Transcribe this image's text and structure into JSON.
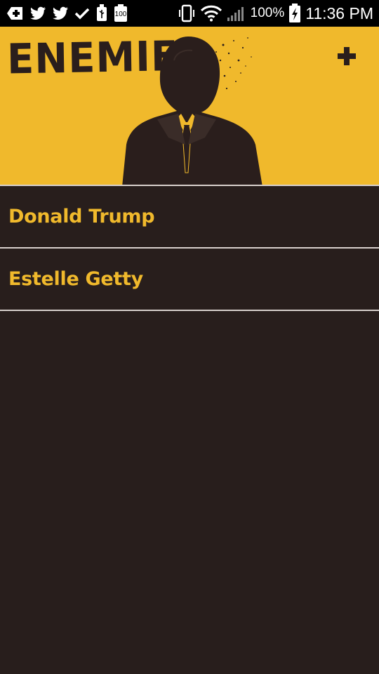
{
  "status_bar": {
    "battery_text": "100%",
    "battery_small_label": "100",
    "time": "11:36 PM",
    "icons": [
      "plus-badge-icon",
      "twitter-icon",
      "twitter-icon",
      "check-icon",
      "usb-icon",
      "battery-small-icon",
      "vibrate-icon",
      "wifi-icon",
      "signal-icon",
      "battery-charging-icon"
    ]
  },
  "header": {
    "title": "ENEMIES",
    "add_icon": "plus-icon",
    "background_color": "#f0b92c",
    "accent_color": "#2a1e1c"
  },
  "enemies": [
    {
      "name": "Donald Trump"
    },
    {
      "name": "Estelle Getty"
    }
  ],
  "list": {
    "background_color": "#281e1c",
    "text_color": "#f0b92c"
  }
}
